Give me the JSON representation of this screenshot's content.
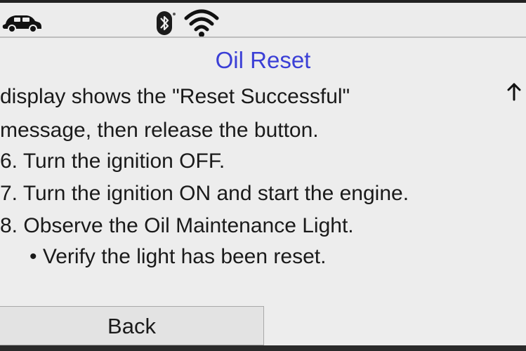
{
  "status_bar": {
    "icons": [
      "car-icon",
      "bluetooth-icon",
      "wifi-icon"
    ]
  },
  "title": "Oil Reset",
  "colors": {
    "title": "#3b3fd6",
    "background": "#ededed",
    "text": "#1a1a1a"
  },
  "content": {
    "lines": [
      "display shows the \"Reset Successful\"",
      "message, then release the button.",
      "6. Turn the ignition OFF.",
      "7. Turn the ignition ON and start the engine.",
      "8. Observe the Oil Maintenance Light.",
      "• Verify the light has been reset."
    ],
    "scroll_indicator": "↑"
  },
  "footer": {
    "back_label": "Back"
  }
}
